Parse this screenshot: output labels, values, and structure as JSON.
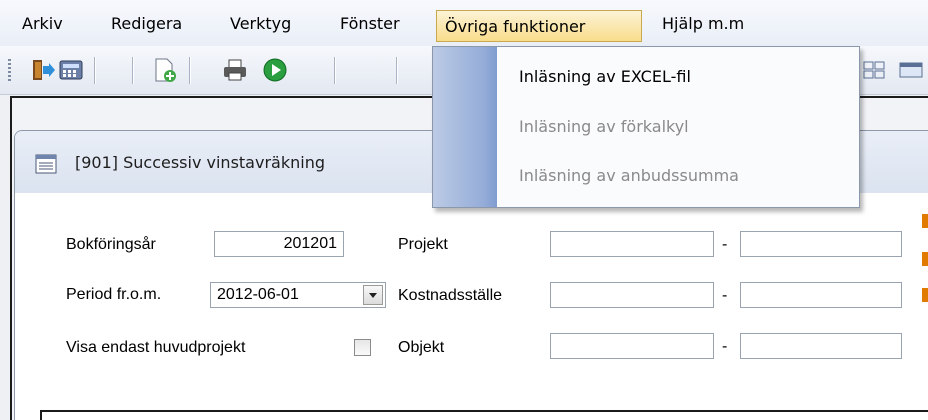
{
  "menubar": {
    "items": [
      "Arkiv",
      "Redigera",
      "Verktyg",
      "Fönster",
      "Övriga funktioner",
      "Hjälp m.m"
    ]
  },
  "toolbar": {
    "icons": [
      "exit-icon",
      "calculator-icon",
      "new-document-icon",
      "print-icon",
      "run-icon"
    ]
  },
  "dropdown": {
    "items": [
      {
        "label": "Inläsning av EXCEL-fil",
        "enabled": true
      },
      {
        "label": "Inläsning av förkalkyl",
        "enabled": false
      },
      {
        "label": "Inläsning av anbudssumma",
        "enabled": false
      }
    ]
  },
  "window": {
    "title": "[901]  Successiv vinstavräkning"
  },
  "form": {
    "bokforingsar_label": "Bokföringsår",
    "bokforingsar_value": "201201",
    "period_label": "Period fr.o.m.",
    "period_value": "2012-06-01",
    "visa_label": "Visa endast huvudprojekt",
    "projekt_label": "Projekt",
    "kostnadsstalle_label": "Kostnadsställe",
    "objekt_label": "Objekt",
    "dash": "-"
  },
  "colors": {
    "accent_orange": "#e07b00",
    "menu_highlight": "#f9dd8b",
    "disabled_text": "#8a8a8a"
  }
}
